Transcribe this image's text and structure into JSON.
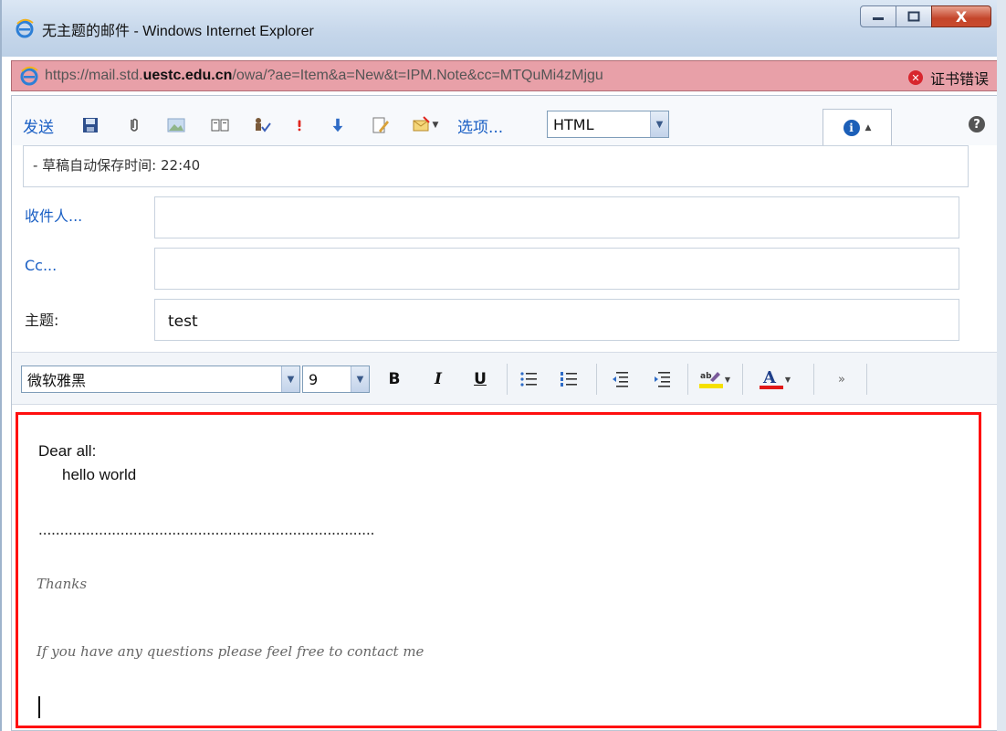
{
  "window": {
    "title": "无主题的邮件 - Windows Internet Explorer",
    "minimize_label": "—",
    "maximize_label": "□",
    "close_label": "X"
  },
  "address": {
    "url_prefix": "https://mail.std.",
    "url_domain": "uestc.edu.cn",
    "url_suffix": "/owa/?ae=Item&a=New&t=IPM.Note&cc=MTQuMi4zMjgu",
    "cert_error": "证书错误"
  },
  "toolbar": {
    "send_label": "发送",
    "options_label": "选项...",
    "format_value": "HTML"
  },
  "draft": {
    "text": "- 草稿自动保存时间: 22:40"
  },
  "fields": {
    "to_label": "收件人...",
    "to_value": "",
    "cc_label": "Cc...",
    "cc_value": "",
    "subject_label": "主题:",
    "subject_value": "test"
  },
  "format_bar": {
    "font_value": "微软雅黑",
    "size_value": "9",
    "bold": "B",
    "italic": "I",
    "underline": "U"
  },
  "body": {
    "line1": "Dear all:",
    "line2": "hello world",
    "dots": "..............................................................................",
    "sig1": "Thanks",
    "sig2": "If you have any questions please feel free to contact me"
  },
  "colors": {
    "link_blue": "#1a5fc4",
    "editor_border": "#ff1010",
    "address_bg": "#e8a0a8",
    "font_color_underline": "#e01818",
    "highlight_yellow": "#f5e000"
  }
}
